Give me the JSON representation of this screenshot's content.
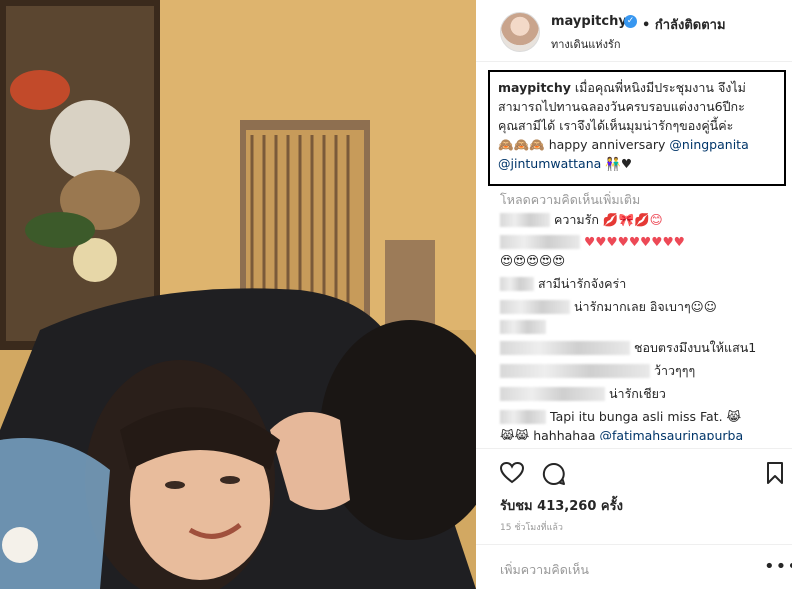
{
  "post": {
    "username": "maypitchy",
    "follow_state": "• กำลังติดตาม",
    "location": "ทางเดินแห่งรัก",
    "verified_mark": "✓"
  },
  "caption": {
    "username": "maypitchy",
    "line1": "เมื่อคุณพี่หนิงมีประชุมงาน จึงไม่",
    "line2": "สามารถไปทานฉลองวันครบรอบแต่งงาน6ปีกะ",
    "line3": "คุณสามีได้ เราจึงได้เห็นมุมน่ารักๆของคู่นี้ค่ะ",
    "line4_emoji": "🙈🙈🙈",
    "line4_text": "happy anniversary",
    "mention1": "@ningpanita",
    "mention2": "@jintumwattana",
    "line5_emoji": "👫♥"
  },
  "load_more": "โหลดความคิดเห็นเพิ่มเติม",
  "comments": [
    {
      "text": "ความรัก",
      "emoji": "💋🎀💋😊"
    },
    {
      "text": "",
      "emoji": "♥♥♥♥♥♥♥♥♥",
      "emoji2": "😍😍😍😍😍"
    },
    {
      "text": "สามีน่ารักจังคร่า",
      "emoji": ""
    },
    {
      "text": "น่ารักมากเลย อิจเบาๆ☺☺",
      "emoji": ""
    },
    {
      "text": "",
      "emoji": ""
    },
    {
      "text": "ชอบตรงมึงบนให้แสน1",
      "emoji": ""
    },
    {
      "text": "ว้าวๆๆๆ",
      "emoji": ""
    },
    {
      "text": "น่ารักเชียว",
      "emoji": ""
    },
    {
      "text": "Tapi itu bunga asli miss Fat.",
      "emoji": "😹"
    },
    {
      "text": "hahhahaa",
      "mention": "@fatimahsaurinapurba",
      "emoji": "😹😹"
    }
  ],
  "actions": {
    "like_icon": "heart-outline",
    "comment_icon": "speech-bubble",
    "save_icon": "bookmark"
  },
  "likes": "รับชม 413,260 ครั้ง",
  "timestamp": "15 ชั่วโมงที่แล้ว",
  "add_comment_placeholder": "เพิ่มความคิดเห็น",
  "more_options": "•••"
}
